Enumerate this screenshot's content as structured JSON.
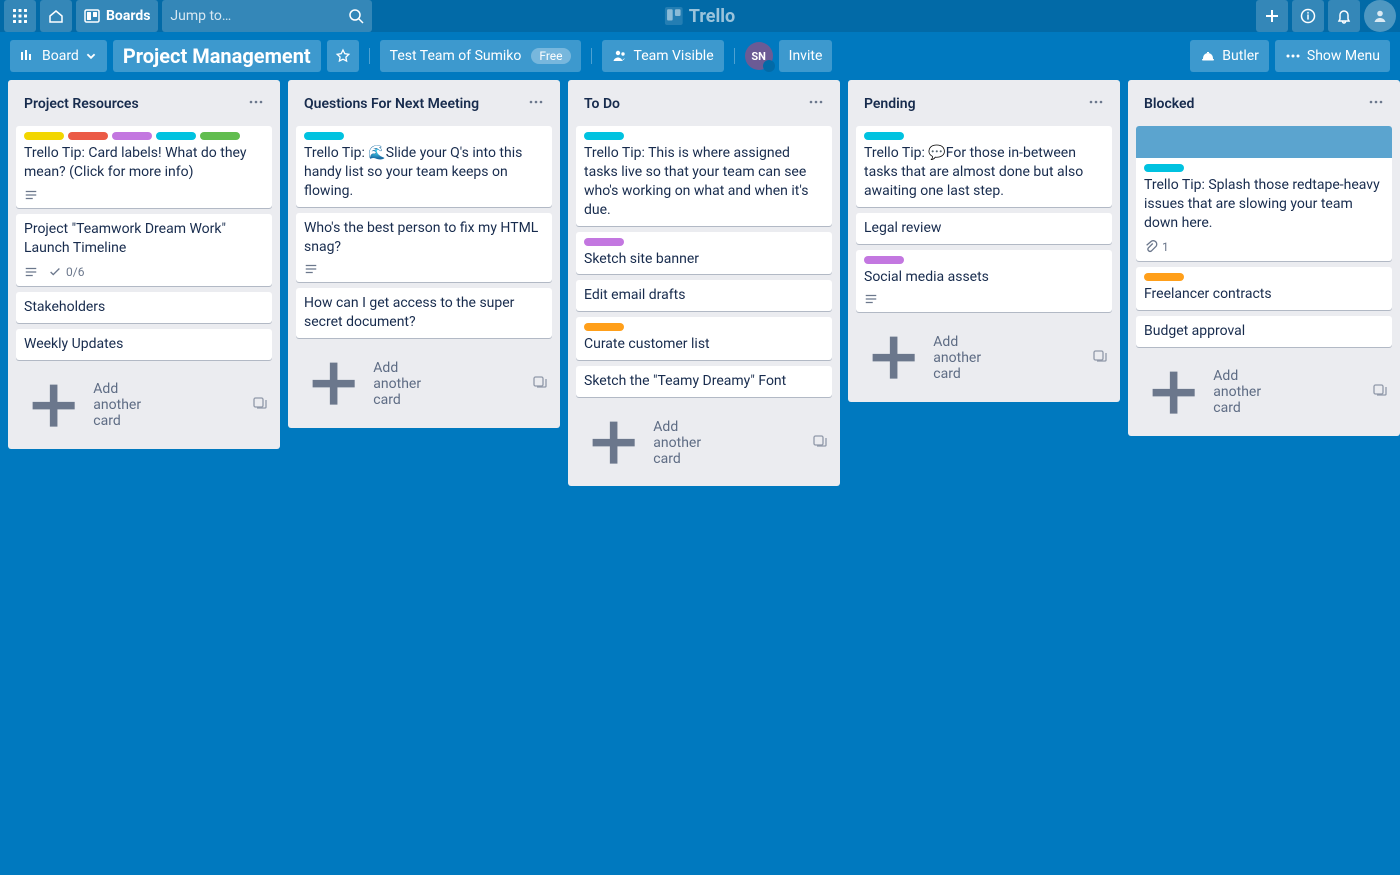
{
  "header": {
    "boards_label": "Boards",
    "search_placeholder": "Jump to…",
    "logo_text": "Trello"
  },
  "boardbar": {
    "view_label": "Board",
    "board_title": "Project Management",
    "team_label": "Test Team of Sumiko",
    "team_badge": "Free",
    "visibility_label": "Team Visible",
    "member_initials": "SN",
    "invite_label": "Invite",
    "butler_label": "Butler",
    "showmenu_label": "Show Menu"
  },
  "lists": [
    {
      "title": "Project Resources",
      "cards": [
        {
          "labels": [
            "yellow",
            "red",
            "purple",
            "sky",
            "green"
          ],
          "text": "Trello Tip: Card labels! What do they mean? (Click for more info)",
          "desc": true
        },
        {
          "text": "Project \"Teamwork Dream Work\" Launch Timeline",
          "desc": true,
          "checklist": "0/6"
        },
        {
          "text": "Stakeholders"
        },
        {
          "text": "Weekly Updates"
        }
      ]
    },
    {
      "title": "Questions For Next Meeting",
      "cards": [
        {
          "labels": [
            "sky"
          ],
          "text": "Trello Tip: 🌊Slide your Q's into this handy list so your team keeps on flowing."
        },
        {
          "text": "Who's the best person to fix my HTML snag?",
          "desc": true
        },
        {
          "text": "How can I get access to the super secret document?"
        }
      ]
    },
    {
      "title": "To Do",
      "cards": [
        {
          "labels": [
            "sky"
          ],
          "text": "Trello Tip: This is where assigned tasks live so that your team can see who's working on what and when it's due."
        },
        {
          "labels": [
            "purple"
          ],
          "text": "Sketch site banner"
        },
        {
          "text": "Edit email drafts"
        },
        {
          "labels": [
            "orange"
          ],
          "text": "Curate customer list"
        },
        {
          "text": "Sketch the \"Teamy Dreamy\" Font"
        }
      ]
    },
    {
      "title": "Pending",
      "cards": [
        {
          "labels": [
            "sky"
          ],
          "text": "Trello Tip: 💬For those in-between tasks that are almost done but also awaiting one last step."
        },
        {
          "text": "Legal review"
        },
        {
          "labels": [
            "purple"
          ],
          "text": "Social media assets",
          "desc": true
        }
      ]
    },
    {
      "title": "Blocked",
      "cards": [
        {
          "labels": [
            "sky"
          ],
          "cover": true,
          "text": "Trello Tip: Splash those redtape-heavy issues that are slowing your team down here.",
          "attach": "1"
        },
        {
          "labels": [
            "orange"
          ],
          "text": "Freelancer contracts"
        },
        {
          "text": "Budget approval"
        }
      ]
    }
  ],
  "add_card_label": "Add another card"
}
